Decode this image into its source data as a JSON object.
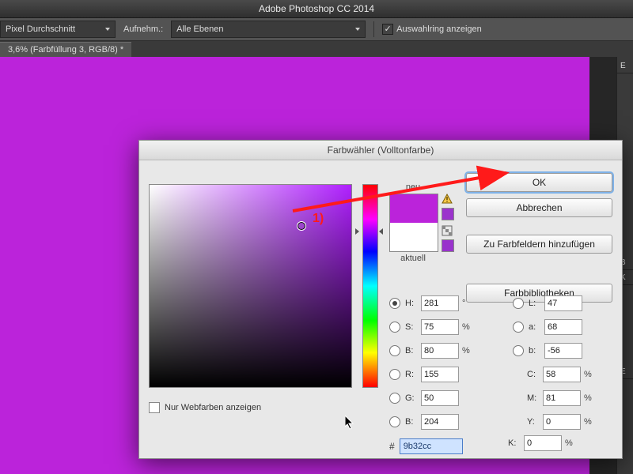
{
  "app": {
    "title": "Adobe Photoshop CC 2014"
  },
  "optbar": {
    "sample": "Pixel Durchschnitt",
    "sample_label": "Aufnehm.:",
    "layers": "Alle Ebenen",
    "show_ring": "Auswahlring anzeigen"
  },
  "doc": {
    "tab": "3,6% (Farbfüllung 3, RGB/8) *"
  },
  "panels": {
    "p1": "E",
    "p2": "B",
    "p3": "K",
    "p4": "E"
  },
  "picker": {
    "title": "Farbwähler (Volltonfarbe)",
    "neu": "neu",
    "aktuell": "aktuell",
    "ok": "OK",
    "cancel": "Abbrechen",
    "add": "Zu Farbfeldern hinzufügen",
    "libs": "Farbbibliotheken",
    "webonly": "Nur Webfarben anzeigen",
    "hex": "9b32cc",
    "swatch_new": "#bb23da",
    "swatch_cur": "#ffffff",
    "fields": {
      "H": {
        "label": "H:",
        "value": "281",
        "unit": "°"
      },
      "S": {
        "label": "S:",
        "value": "75",
        "unit": "%"
      },
      "B": {
        "label": "B:",
        "value": "80",
        "unit": "%"
      },
      "R": {
        "label": "R:",
        "value": "155",
        "unit": ""
      },
      "G": {
        "label": "G:",
        "value": "50",
        "unit": ""
      },
      "Bl": {
        "label": "B:",
        "value": "204",
        "unit": ""
      },
      "L": {
        "label": "L:",
        "value": "47",
        "unit": ""
      },
      "a": {
        "label": "a:",
        "value": "68",
        "unit": ""
      },
      "b": {
        "label": "b:",
        "value": "-56",
        "unit": ""
      },
      "C": {
        "label": "C:",
        "value": "58",
        "unit": "%"
      },
      "M": {
        "label": "M:",
        "value": "81",
        "unit": "%"
      },
      "Y": {
        "label": "Y:",
        "value": "0",
        "unit": "%"
      },
      "K": {
        "label": "K:",
        "value": "0",
        "unit": "%"
      }
    }
  },
  "annotation": {
    "num": "1)"
  }
}
